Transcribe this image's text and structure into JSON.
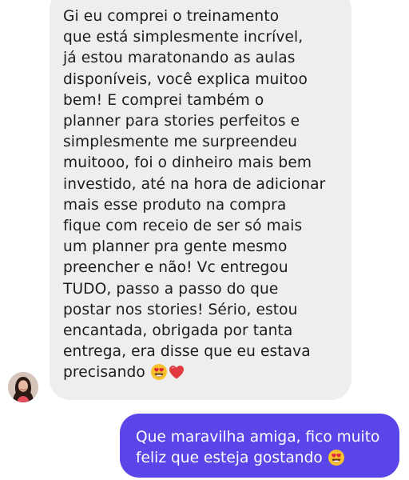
{
  "incoming_message": {
    "lines": [
      "Gi eu comprei o treinamento",
      "que está simplesmente incrível,",
      "já estou maratonando as aulas",
      "disponíveis, você explica muitoo",
      "bem! E comprei também o",
      "planner para stories perfeitos e",
      "simplesmente me surpreendeu",
      "muitooo, foi o dinheiro mais bem",
      "investido, até na hora de adicionar",
      "mais esse produto na compra",
      "fique com receio de ser só mais",
      "um planner pra gente mesmo",
      "preencher e não! Vc entregou",
      "TUDO, passo a passo do que",
      "postar nos stories! Sério, estou",
      "encantada, obrigada por tanta",
      "entrega, era disse que eu estava",
      "precisando"
    ],
    "trailing_emojis": [
      "heart-eyes-emoji",
      "red-heart-emoji"
    ]
  },
  "sender_avatar": {
    "icon": "profile-photo-avatar"
  },
  "outgoing_message": {
    "lines": [
      "Que maravilha amiga, fico muito",
      "feliz que esteja gostando"
    ],
    "trailing_emojis": [
      "heart-eyes-emoji"
    ]
  },
  "colors": {
    "incoming_bubble": "#eeeeef",
    "outgoing_bubble": "#5a45e8",
    "incoming_text": "#1c1c1c",
    "outgoing_text": "#ffffff"
  }
}
